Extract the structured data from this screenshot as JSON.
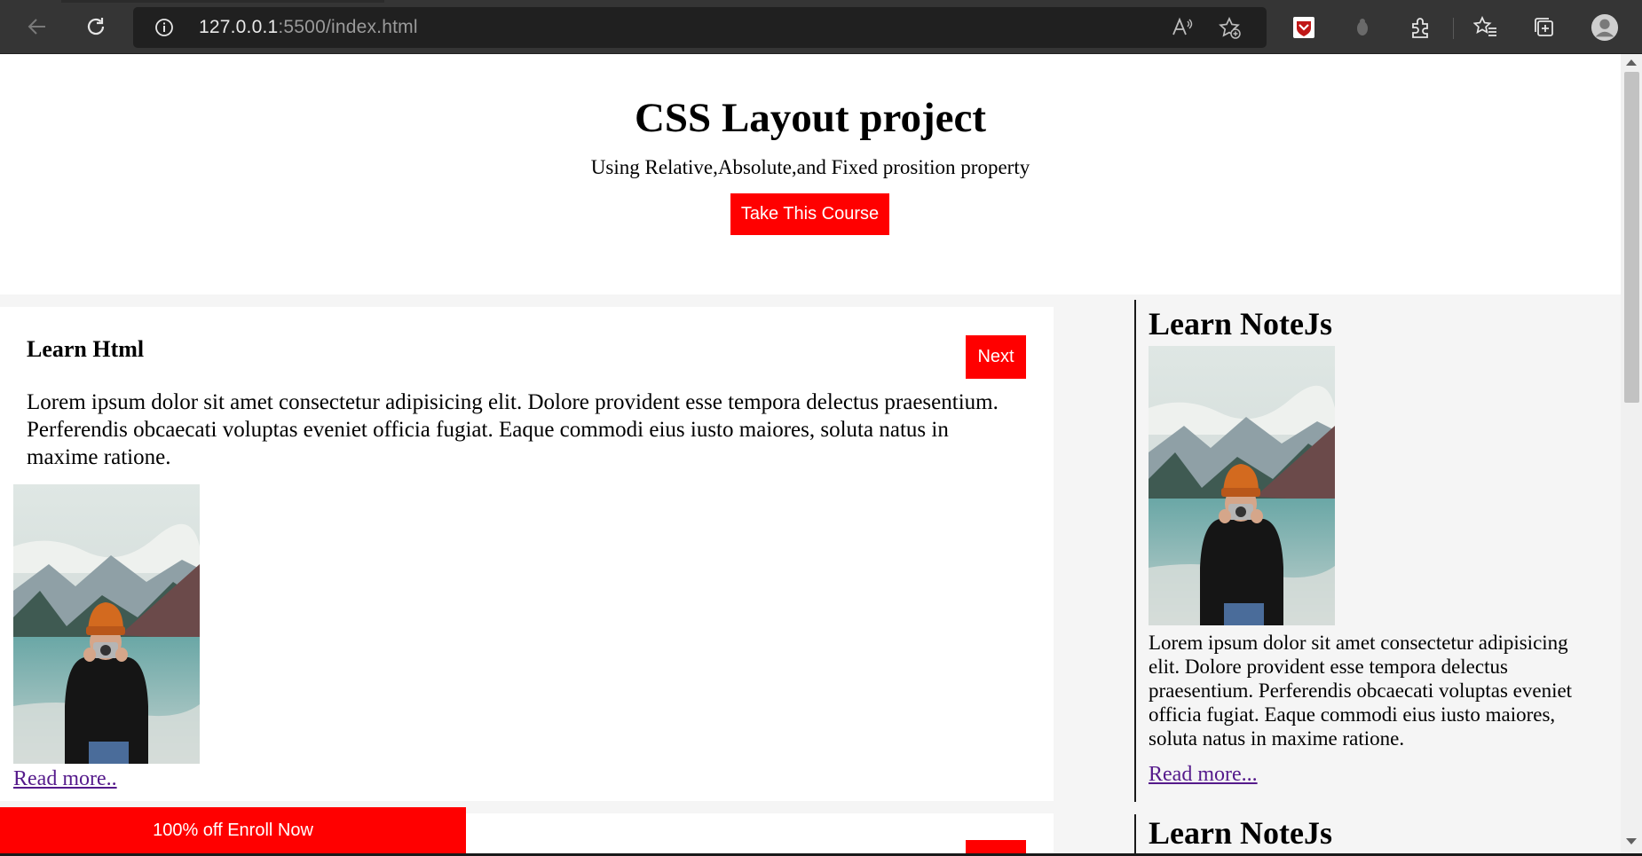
{
  "browser": {
    "url_host": "127.0.0.1",
    "url_path": ":5500/index.html"
  },
  "hero": {
    "title": "CSS Layout project",
    "subtitle": "Using Relative,Absolute,and Fixed prosition property",
    "cta_label": "Take This Course"
  },
  "card1": {
    "title": "Learn Html",
    "next_label": "Next",
    "text": "Lorem ipsum dolor sit amet consectetur adipisicing elit. Dolore provident esse tempora delectus praesentium. Perferendis obcaecati voluptas eveniet officia fugiat. Eaque commodi eius iusto maiores, soluta natus in maxime ratione.",
    "read_more": "Read more.."
  },
  "aside1": {
    "title": "Learn NoteJs",
    "text": "Lorem ipsum dolor sit amet consectetur adipisicing elit. Dolore provident esse tempora delectus praesentium. Perferendis obcaecati voluptas eveniet officia fugiat. Eaque commodi eius iusto maiores, soluta natus in maxime ratione.",
    "read_more": "Read more..."
  },
  "aside2": {
    "title": "Learn NoteJs"
  },
  "enroll": {
    "label": "100% off Enroll Now"
  },
  "colors": {
    "accent": "#ff0000",
    "link_visited": "#551a8b",
    "chrome_bg": "#353535"
  }
}
